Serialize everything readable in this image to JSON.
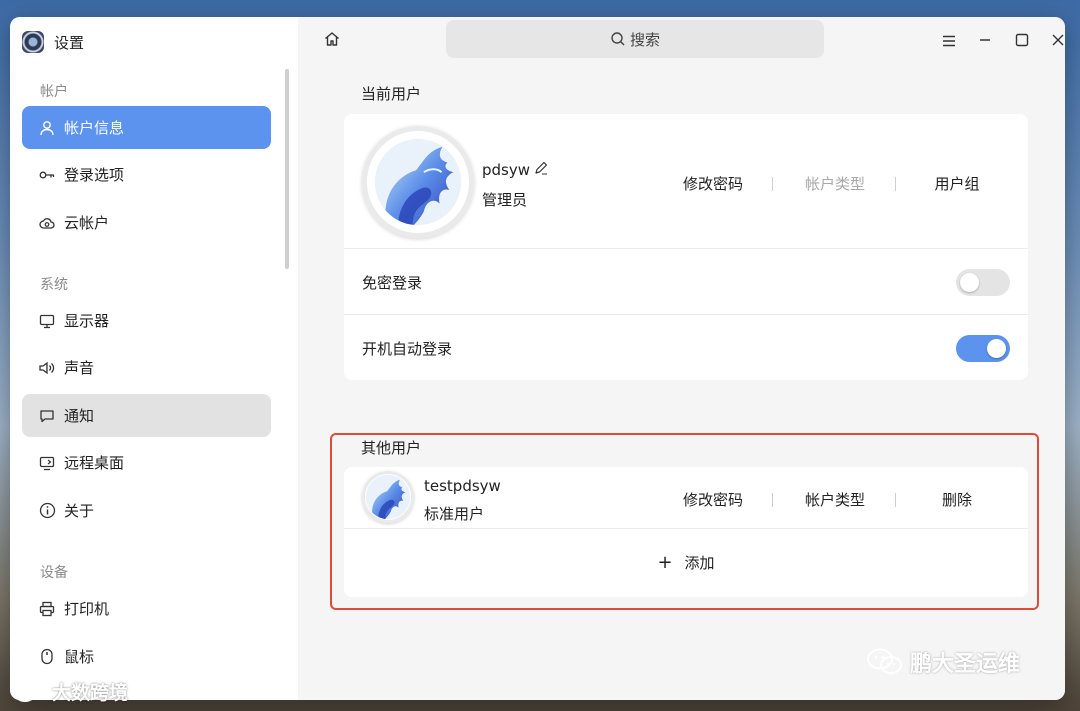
{
  "app": {
    "title": "设置"
  },
  "sidebar": {
    "sections": [
      {
        "title": "帐户",
        "items": [
          {
            "label": "帐户信息",
            "icon": "user-icon",
            "state": "active"
          },
          {
            "label": "登录选项",
            "icon": "key-icon"
          },
          {
            "label": "云帐户",
            "icon": "cloud-icon"
          }
        ]
      },
      {
        "title": "系统",
        "items": [
          {
            "label": "显示器",
            "icon": "monitor-icon"
          },
          {
            "label": "声音",
            "icon": "speaker-icon"
          },
          {
            "label": "通知",
            "icon": "chat-icon",
            "state": "hover"
          },
          {
            "label": "远程桌面",
            "icon": "remote-desktop-icon"
          },
          {
            "label": "关于",
            "icon": "info-icon"
          }
        ]
      },
      {
        "title": "设备",
        "items": [
          {
            "label": "打印机",
            "icon": "printer-icon"
          },
          {
            "label": "鼠标",
            "icon": "mouse-icon"
          }
        ]
      }
    ]
  },
  "header": {
    "search_label": "搜索"
  },
  "current_user": {
    "title": "当前用户",
    "username": "pdsyw",
    "role": "管理员",
    "actions": [
      {
        "label": "修改密码",
        "enabled": true
      },
      {
        "label": "帐户类型",
        "enabled": false
      },
      {
        "label": "用户组",
        "enabled": true
      }
    ],
    "settings": [
      {
        "label": "免密登录",
        "enabled": false
      },
      {
        "label": "开机自动登录",
        "enabled": true
      }
    ]
  },
  "other_users": {
    "title": "其他用户",
    "users": [
      {
        "username": "testpdsyw",
        "role": "标准用户",
        "actions": [
          {
            "label": "修改密码"
          },
          {
            "label": "帐户类型"
          },
          {
            "label": "删除"
          }
        ]
      }
    ],
    "add_label": "添加"
  },
  "watermarks": {
    "right": "鹏大圣运维",
    "left": "大数跨境"
  },
  "colors": {
    "accent": "#5b93ee",
    "highlight_border": "#e04a3a"
  }
}
